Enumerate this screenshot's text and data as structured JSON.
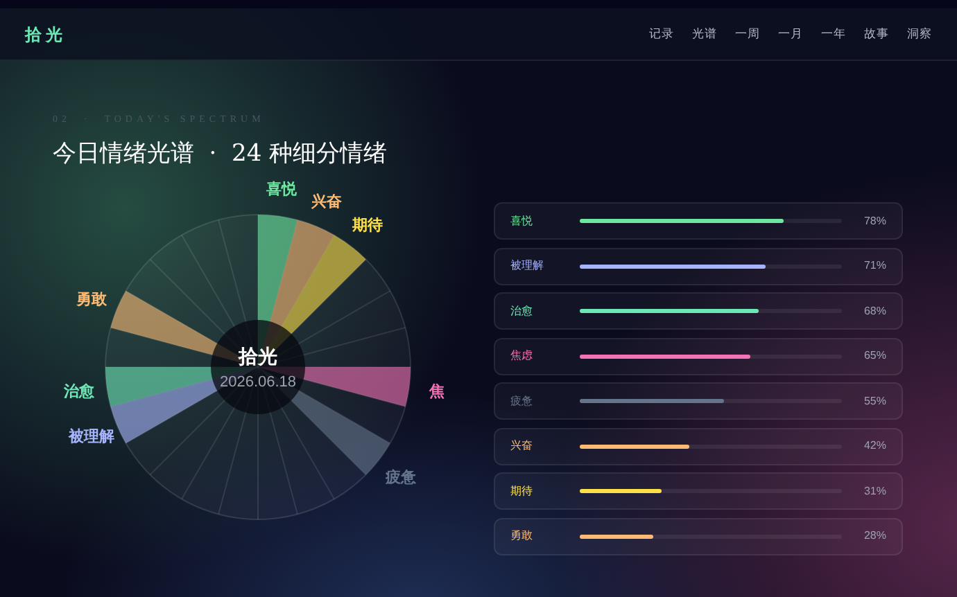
{
  "nav": {
    "logo": "拾光",
    "items": [
      "记录",
      "光谱",
      "一周",
      "一月",
      "一年",
      "故事",
      "洞察"
    ]
  },
  "header": {
    "eyebrow": "02  ·  TODAY'S SPECTRUM",
    "title": "今日情绪光谱  ·  24 种细分情绪"
  },
  "wheel": {
    "center_title": "拾光",
    "center_date": "2026.06.18",
    "right_half": [
      {
        "kind": "emotion",
        "label": "喜悦",
        "color": "#6ee7a0"
      },
      {
        "kind": "emotion",
        "label": "兴奋",
        "color": "#fdba74"
      },
      {
        "kind": "emotion",
        "label": "期待",
        "color": "#fde047"
      },
      {
        "kind": "empty"
      },
      {
        "kind": "empty"
      },
      {
        "kind": "empty"
      },
      {
        "kind": "emotion",
        "label": "焦",
        "color": "#f472b6"
      },
      {
        "kind": "empty"
      },
      {
        "kind": "emotion",
        "label": "疲惫",
        "color": "#64748b"
      },
      {
        "kind": "empty"
      },
      {
        "kind": "empty"
      },
      {
        "kind": "empty"
      }
    ],
    "left_half": [
      {
        "kind": "empty"
      },
      {
        "kind": "empty"
      },
      {
        "kind": "empty"
      },
      {
        "kind": "empty"
      },
      {
        "kind": "emotion",
        "label": "勇敢",
        "color": "#fdba74"
      },
      {
        "kind": "empty"
      },
      {
        "kind": "emotion",
        "label": "治愈",
        "color": "#6ee7b7"
      },
      {
        "kind": "emotion",
        "label": "被理解",
        "color": "#a5b4fc"
      },
      {
        "kind": "empty"
      },
      {
        "kind": "empty"
      },
      {
        "kind": "empty"
      },
      {
        "kind": "empty"
      }
    ]
  },
  "bars": [
    {
      "label": "喜悦",
      "color": "#6ee7a0",
      "level": 0.78,
      "reading": "78%"
    },
    {
      "label": "被理解",
      "color": "#a5b4fc",
      "level": 0.71,
      "reading": "71%"
    },
    {
      "label": "治愈",
      "color": "#6ee7b7",
      "level": 0.68,
      "reading": "68%"
    },
    {
      "label": "焦虑",
      "color": "#f472b6",
      "level": 0.65,
      "reading": "65%"
    },
    {
      "label": "疲惫",
      "color": "#64748b",
      "level": 0.55,
      "reading": "55%"
    },
    {
      "label": "兴奋",
      "color": "#fdba74",
      "level": 0.42,
      "reading": "42%"
    },
    {
      "label": "期待",
      "color": "#fde047",
      "level": 0.31,
      "reading": "31%"
    },
    {
      "label": "勇敢",
      "color": "#fdba74",
      "level": 0.28,
      "reading": "28%"
    }
  ]
}
